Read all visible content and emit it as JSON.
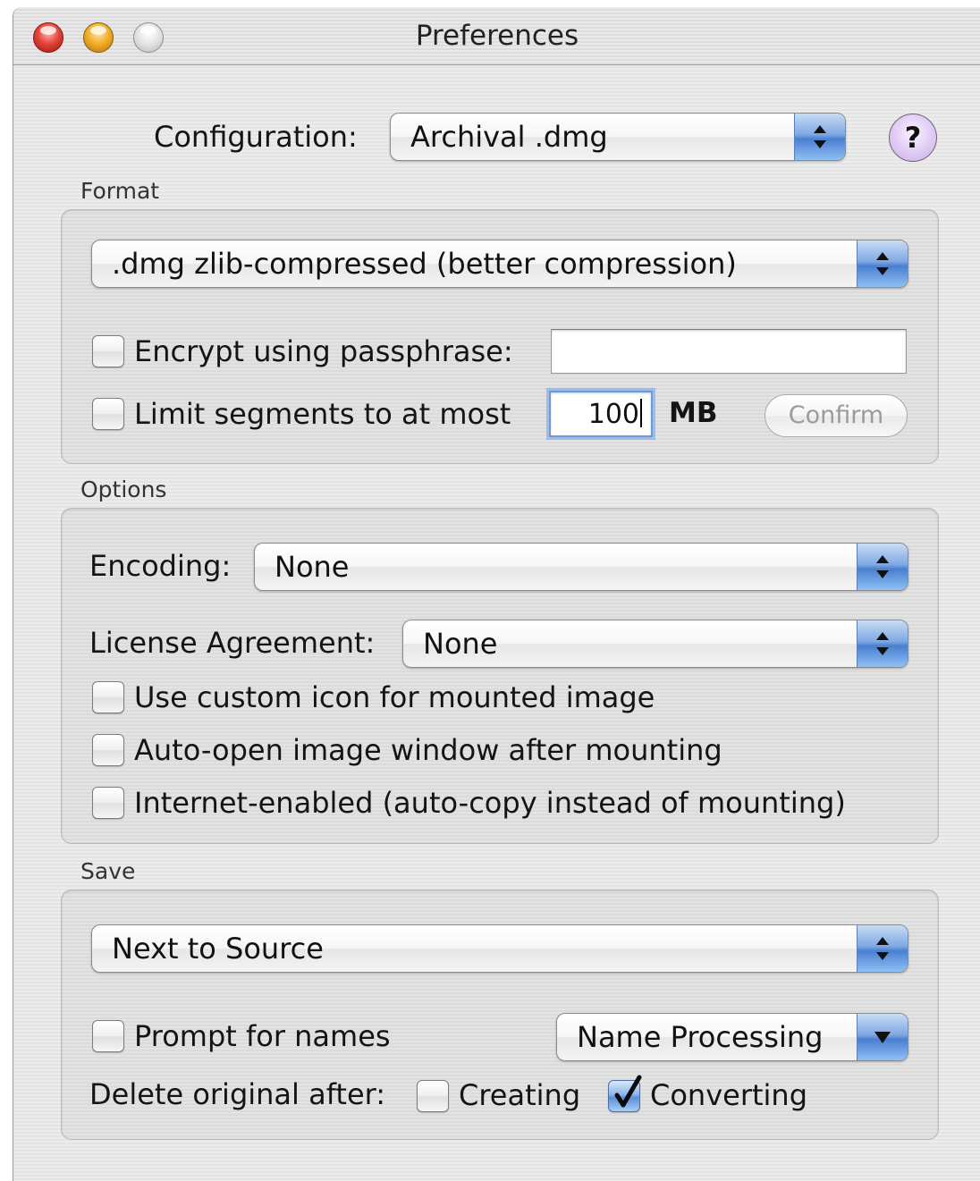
{
  "window": {
    "title": "Preferences"
  },
  "configuration": {
    "label": "Configuration:",
    "value": "Archival .dmg",
    "help": "?"
  },
  "format": {
    "section_label": "Format",
    "format_value": ".dmg zlib-compressed (better compression)",
    "encrypt_label": "Encrypt using passphrase:",
    "encrypt_checked": false,
    "passphrase_value": "",
    "limit_label": "Limit segments to at most",
    "limit_checked": false,
    "segment_size": "100",
    "unit": "MB",
    "confirm_label": "Confirm"
  },
  "options": {
    "section_label": "Options",
    "encoding_label": "Encoding:",
    "encoding_value": "None",
    "license_label": "License Agreement:",
    "license_value": "None",
    "custom_icon_label": "Use custom icon for mounted image",
    "auto_open_label": "Auto-open image window after mounting",
    "internet_enabled_label": "Internet-enabled (auto-copy instead of mounting)"
  },
  "save": {
    "section_label": "Save",
    "location_value": "Next to Source",
    "prompt_label": "Prompt for names",
    "name_processing_label": "Name Processing",
    "delete_label": "Delete original after:",
    "creating_label": "Creating",
    "creating_checked": false,
    "converting_label": "Converting",
    "converting_checked": true
  }
}
